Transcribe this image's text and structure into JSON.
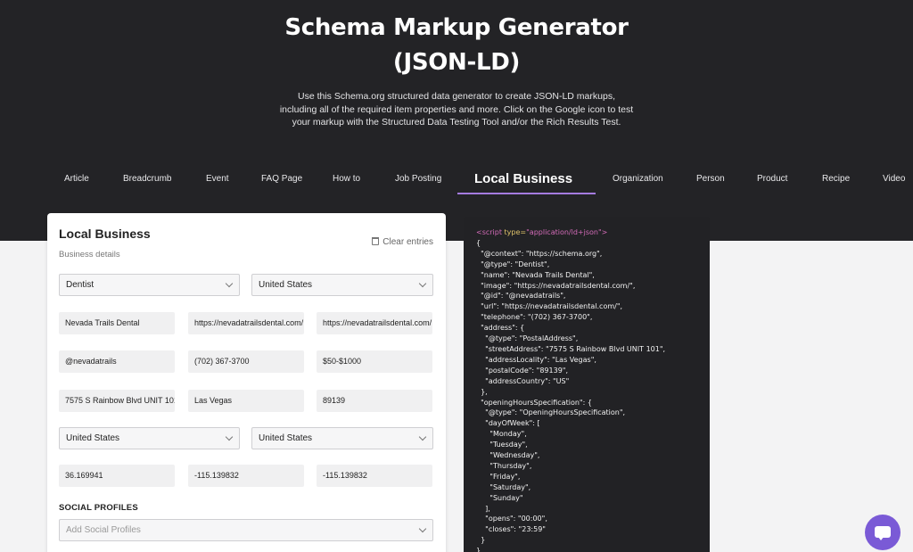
{
  "hero": {
    "title_line1": "Schema Markup Generator",
    "title_line2": "(JSON-LD)",
    "description": "Use this Schema.org structured data generator to create JSON-LD markups, including all of the required item properties and more. Click on the Google icon to test your markup with the Structured Data Testing Tool and/or the Rich Results Test."
  },
  "tabs": [
    {
      "label": "Article"
    },
    {
      "label": "Breadcrumb"
    },
    {
      "label": "Event"
    },
    {
      "label": "FAQ Page"
    },
    {
      "label": "How to"
    },
    {
      "label": "Job Posting"
    },
    {
      "label": "Local Business",
      "active": true
    },
    {
      "label": "Organization"
    },
    {
      "label": "Person"
    },
    {
      "label": "Product"
    },
    {
      "label": "Recipe"
    },
    {
      "label": "Video"
    }
  ],
  "form": {
    "title": "Local Business",
    "subtitle": "Business details",
    "clear_label": "Clear entries",
    "business_type": "Dentist",
    "country_select_1": "United States",
    "name": "Nevada Trails Dental",
    "image_url": "https://nevadatrailsdental.com/",
    "url": "https://nevadatrailsdental.com/",
    "id": "@nevadatrails",
    "telephone": "(702) 367-3700",
    "price_range": "$50-$1000",
    "street": "7575 S Rainbow Blvd UNIT 101",
    "city": "Las Vegas",
    "zip": "89139",
    "country_select_2": "United States",
    "country_select_3": "United States",
    "latitude": "36.169941",
    "longitude": "-115.139832",
    "geo_extra": "-115.139832",
    "social_label": "SOCIAL PROFILES",
    "social_placeholder": "Add Social Profiles"
  },
  "code": {
    "open_tag": "<script",
    "type_attr": " type=",
    "type_value": "\"application/ld+json\">",
    "body": "{\n  \"@context\": \"https://schema.org\",\n  \"@type\": \"Dentist\",\n  \"name\": \"Nevada Trails Dental\",\n  \"image\": \"https://nevadatrailsdental.com/\",\n  \"@id\": \"@nevadatrails\",\n  \"url\": \"https://nevadatrailsdental.com/\",\n  \"telephone\": \"(702) 367-3700\",\n  \"address\": {\n    \"@type\": \"PostalAddress\",\n    \"streetAddress\": \"7575 S Rainbow Blvd UNIT 101\",\n    \"addressLocality\": \"Las Vegas\",\n    \"postalCode\": \"89139\",\n    \"addressCountry\": \"US\"\n  },\n  \"openingHoursSpecification\": {\n    \"@type\": \"OpeningHoursSpecification\",\n    \"dayOfWeek\": [\n      \"Monday\",\n      \"Tuesday\",\n      \"Wednesday\",\n      \"Thursday\",\n      \"Friday\",\n      \"Saturday\",\n      \"Sunday\"\n    ],\n    \"opens\": \"00:00\",\n    \"closes\": \"23:59\"\n  }\n}"
  },
  "colors": {
    "hero_bg": "#232326",
    "accent": "#a57be0",
    "chat_button": "#7a5ad6"
  },
  "icons": {
    "clear": "trash-icon",
    "select": "chevron-down-icon",
    "chat": "chat-icon"
  }
}
